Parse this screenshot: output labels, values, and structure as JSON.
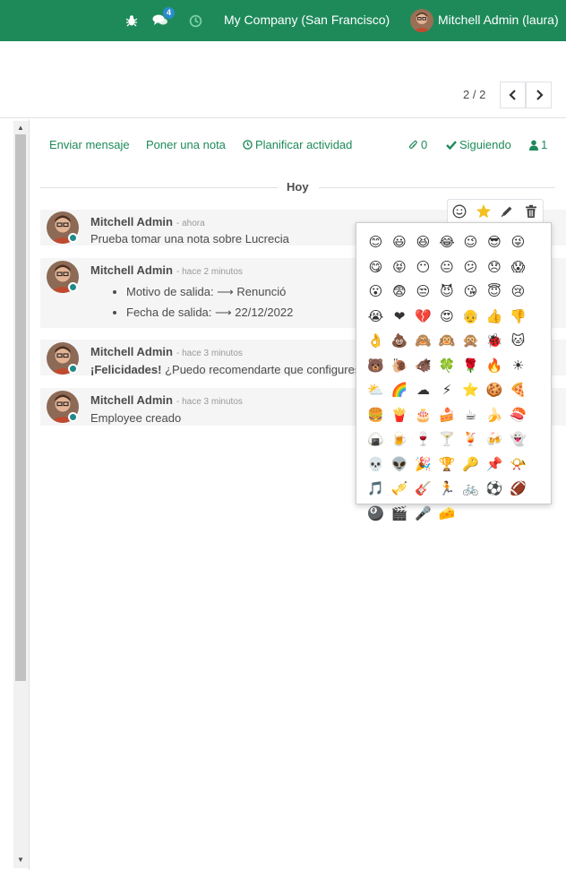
{
  "navbar": {
    "company": "My Company (San Francisco)",
    "user": "Mitchell Admin (laura)",
    "messages_badge": "4"
  },
  "pager": {
    "value": "2 / 2"
  },
  "chatter": {
    "send_message": "Enviar mensaje",
    "log_note": "Poner una nota",
    "schedule_activity": "Planificar actividad",
    "attachments_count": "0",
    "following": "Siguiendo",
    "followers_count": "1",
    "date_separator": "Hoy"
  },
  "messages": [
    {
      "author": "Mitchell Admin",
      "date": "- ahora",
      "body": "Prueba tomar una nota sobre Lucrecia"
    },
    {
      "author": "Mitchell Admin",
      "date": "- hace 2 minutos",
      "items": [
        "Motivo de salida: ⟶ Renunció",
        "Fecha de salida: ⟶ 22/12/2022"
      ]
    },
    {
      "author": "Mitchell Admin",
      "date": "- hace 3 minutos",
      "body_bold": "¡Felicidades!",
      "body": " ¿Puedo recomendarte que configures"
    },
    {
      "author": "Mitchell Admin",
      "date": "- hace 3 minutos",
      "body": "Employee creado"
    }
  ],
  "emojis": [
    "😊",
    "😃",
    "😆",
    "😂",
    "😉",
    "😎",
    "😜",
    "😋",
    "😝",
    "😶",
    "😐",
    "😕",
    "😞",
    "😱",
    "😮",
    "😨",
    "😒",
    "😈",
    "😘",
    "😇",
    "😢",
    "😭",
    "❤",
    "💔",
    "😍",
    "👴",
    "👍",
    "👎",
    "👌",
    "💩",
    "🙈",
    "🙉",
    "🙊",
    "🐞",
    "🐱",
    "🐻",
    "🐌",
    "🐗",
    "🍀",
    "🌹",
    "🔥",
    "☀",
    "⛅",
    "🌈",
    "☁",
    "⚡",
    "⭐",
    "🍪",
    "🍕",
    "🍔",
    "🍟",
    "🎂",
    "🍰",
    "☕",
    "🍌",
    "🍣",
    "🍙",
    "🍺",
    "🍷",
    "🍸",
    "🍹",
    "🍻",
    "👻",
    "💀",
    "👽",
    "🎉",
    "🏆",
    "🔑",
    "📌",
    "📯",
    "🎵",
    "🎺",
    "🎸",
    "🏃",
    "🚲",
    "⚽",
    "🏈",
    "🎱",
    "🎬",
    "🎤",
    "🧀"
  ],
  "colors": {
    "brand": "#1e8a5a",
    "presence": "#1e8a8a"
  }
}
